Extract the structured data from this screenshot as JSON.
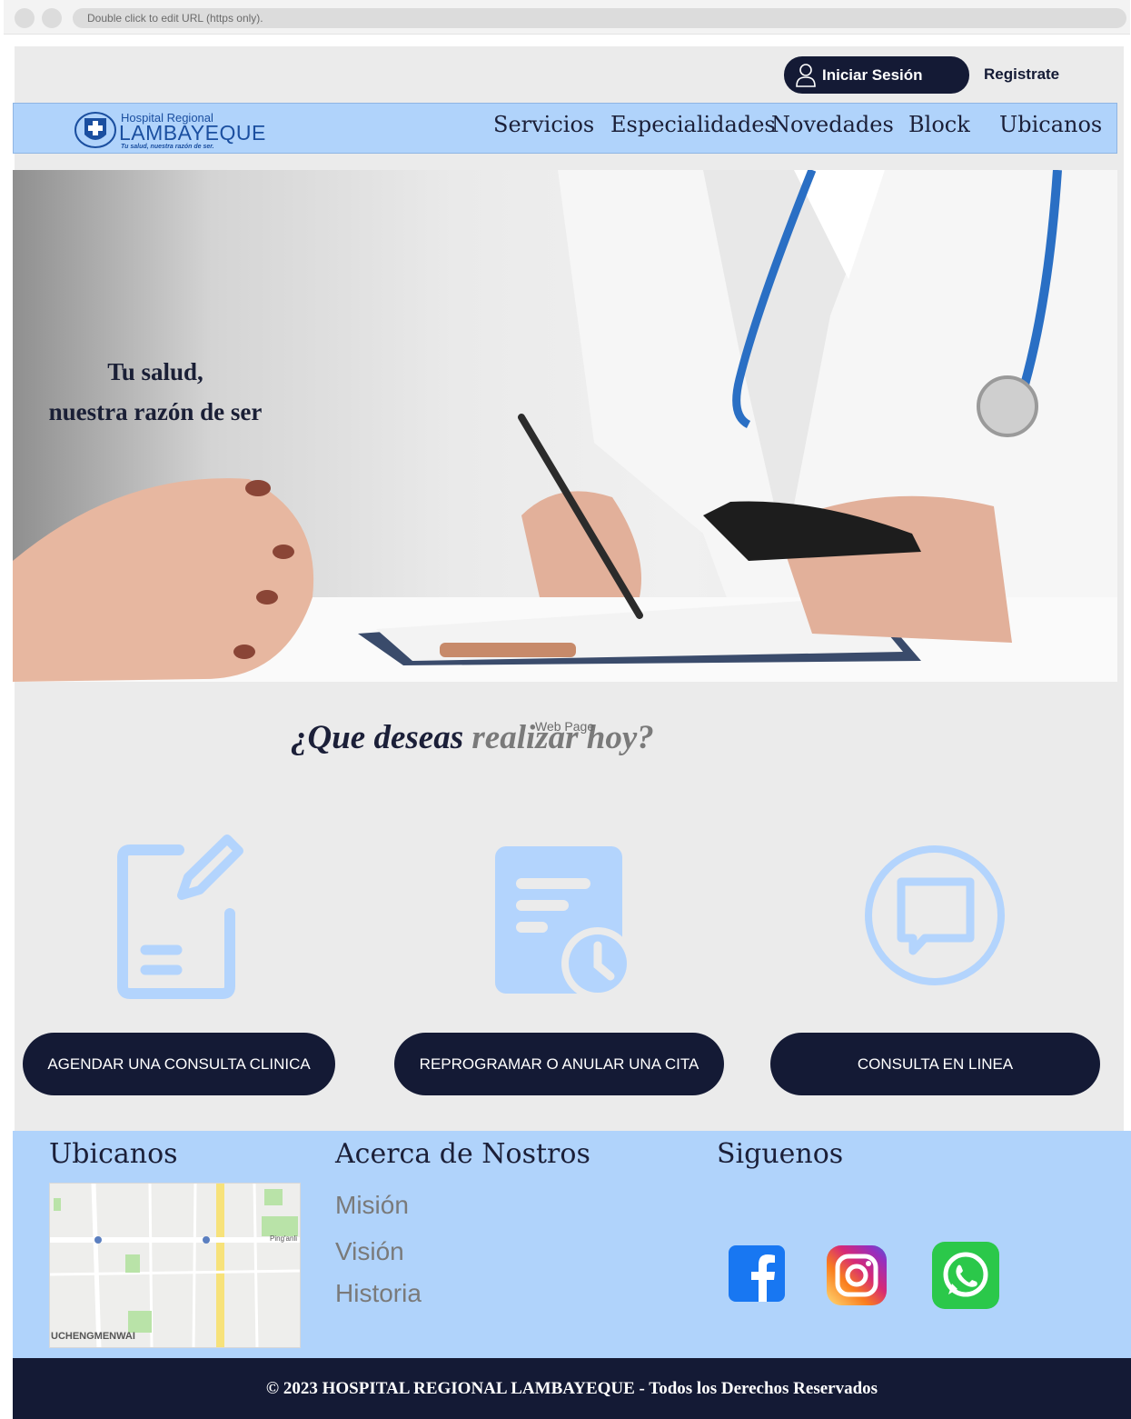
{
  "browser": {
    "url_placeholder": "Double click to edit URL (https only)."
  },
  "header": {
    "login_label": "Iniciar Sesión",
    "register_label": "Registrate"
  },
  "logo": {
    "line1": "Hospital  Regional",
    "line2": "LAMBAYEQUE",
    "tagline": "Tu salud, nuestra razón de ser."
  },
  "nav": {
    "items": [
      "Servicios",
      "Especialidades",
      "Novedades",
      "Block",
      "Ubicanos"
    ]
  },
  "hero": {
    "line1": "Tu salud,",
    "line2": "nuestra razón de ser"
  },
  "question": {
    "part1": "¿Que deseas ",
    "part2": "realizar hoy?"
  },
  "web_page_label": "Web Page",
  "actions": [
    {
      "label": "AGENDAR UNA CONSULTA CLINICA",
      "icon": "edit-document-icon"
    },
    {
      "label": "REPROGRAMAR O ANULAR UNA CITA",
      "icon": "document-clock-icon"
    },
    {
      "label": "CONSULTA EN LINEA",
      "icon": "chat-bubble-icon"
    }
  ],
  "footer": {
    "ubicanos_title": "Ubicanos",
    "about_title": "Acerca de Nostros",
    "follow_title": "Siguenos",
    "about_links": [
      "Misión",
      "Visión",
      "Historia"
    ],
    "map_labels": [
      "Ping'anli",
      "UCHENGMENWAI"
    ],
    "social": [
      "facebook-icon",
      "instagram-icon",
      "whatsapp-icon"
    ]
  },
  "copyright": "© 2023 HOSPITAL REGIONAL LAMBAYEQUE - Todos los Derechos Reservados",
  "colors": {
    "navy": "#141a35",
    "light_blue": "#b0d3fb",
    "icon_blue": "#b3d4fd",
    "page_bg": "#ebebeb"
  }
}
